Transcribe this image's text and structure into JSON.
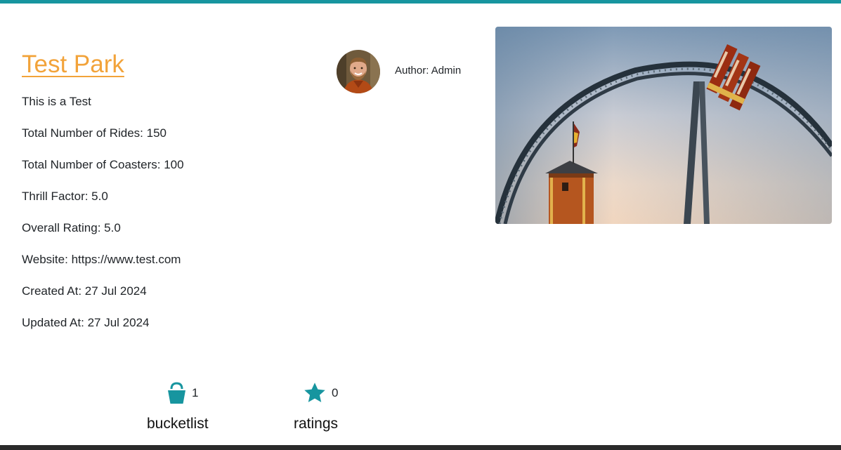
{
  "park": {
    "title": "Test Park",
    "description": "This is a Test",
    "rides_label": "Total Number of Rides: 150",
    "coasters_label": "Total Number of Coasters: 100",
    "thrill_label": "Thrill Factor: 5.0",
    "rating_label": "Overall Rating: 5.0",
    "website_prefix": "Website: ",
    "website_url": "https://www.test.com",
    "created_label": "Created At: 27 Jul 2024",
    "updated_label": "Updated At: 27 Jul 2024"
  },
  "author": {
    "label": "Author: Admin"
  },
  "stats": {
    "bucketlist": {
      "count": "1",
      "label": "bucketlist",
      "icon": "bucket-icon"
    },
    "ratings": {
      "count": "0",
      "label": "ratings",
      "icon": "star-icon"
    }
  },
  "colors": {
    "accent": "#17959f",
    "title": "#f2a33a",
    "text": "#212529",
    "footer": "#2a2a2a"
  }
}
